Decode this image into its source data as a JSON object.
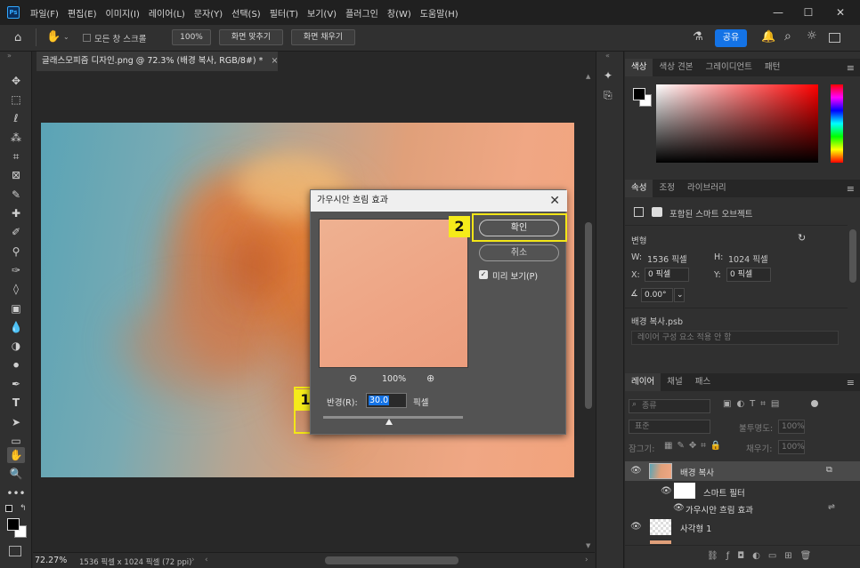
{
  "app": {
    "logo": "Ps"
  },
  "menubar": {
    "items": [
      "파일(F)",
      "편집(E)",
      "이미지(I)",
      "레이어(L)",
      "문자(Y)",
      "선택(S)",
      "필터(T)",
      "보기(V)",
      "플러그인",
      "창(W)",
      "도움말(H)"
    ],
    "window_controls": {
      "minimize": "—",
      "maximize": "☐",
      "close": "✕"
    }
  },
  "options_bar": {
    "scroll_all_windows": "모든 창 스크롤",
    "zoom_value": "100%",
    "fit_screen": "화면 맞추기",
    "fill_screen": "화면 채우기",
    "share": "공유"
  },
  "document": {
    "tab_title": "글래스모피즘 디자인.png @ 72.3% (배경 복사, RGB/8#) *",
    "tab_close": "×"
  },
  "status": {
    "zoom": "72.27%",
    "doc_info": "1536 픽셀 x 1024 픽셀 (72 ppi)"
  },
  "panels": {
    "color_tabs": [
      "색상",
      "색상 견본",
      "그레이디언트",
      "패턴"
    ],
    "properties_tabs": [
      "속성",
      "조정",
      "라이브러리"
    ],
    "properties": {
      "object_type": "포함된 스마트 오브젝트",
      "transform_label": "변형",
      "w_label": "W:",
      "w_value": "1536 픽셀",
      "h_label": "H:",
      "h_value": "1024 픽셀",
      "x_label": "X:",
      "x_value": "0 픽셀",
      "y_label": "Y:",
      "y_value": "0 픽셀",
      "angle_value": "0.00°",
      "psb_name": "배경 복사.psb",
      "layer_comp": "레이어 구성 요소 적용 안 함"
    },
    "layers_tabs": [
      "레이어",
      "채널",
      "패스"
    ],
    "layers": {
      "search_placeholder": "종류",
      "blend_mode": "표준",
      "opacity_label": "불투명도:",
      "opacity_value": "100%",
      "lock_label": "잠그기:",
      "fill_label": "채우기:",
      "fill_value": "100%",
      "rows": [
        {
          "name": "배경 복사"
        },
        {
          "name": "스마트 필터"
        },
        {
          "name": "가우시안 흐림 효과"
        },
        {
          "name": "사각형 1"
        }
      ]
    }
  },
  "dialog": {
    "title": "가우시안 흐림 효과",
    "close": "✕",
    "ok": "확인",
    "cancel": "취소",
    "preview_label": "미리 보기(P)",
    "preview_checked": true,
    "zoom_value": "100%",
    "radius_label": "반경(R):",
    "radius_value": "30.0",
    "radius_unit": "픽셀"
  },
  "callouts": {
    "one": "1",
    "two": "2"
  },
  "colors": {
    "accent": "#1473e6",
    "callout": "#f5eb1a",
    "highlight": "#f3e617"
  }
}
